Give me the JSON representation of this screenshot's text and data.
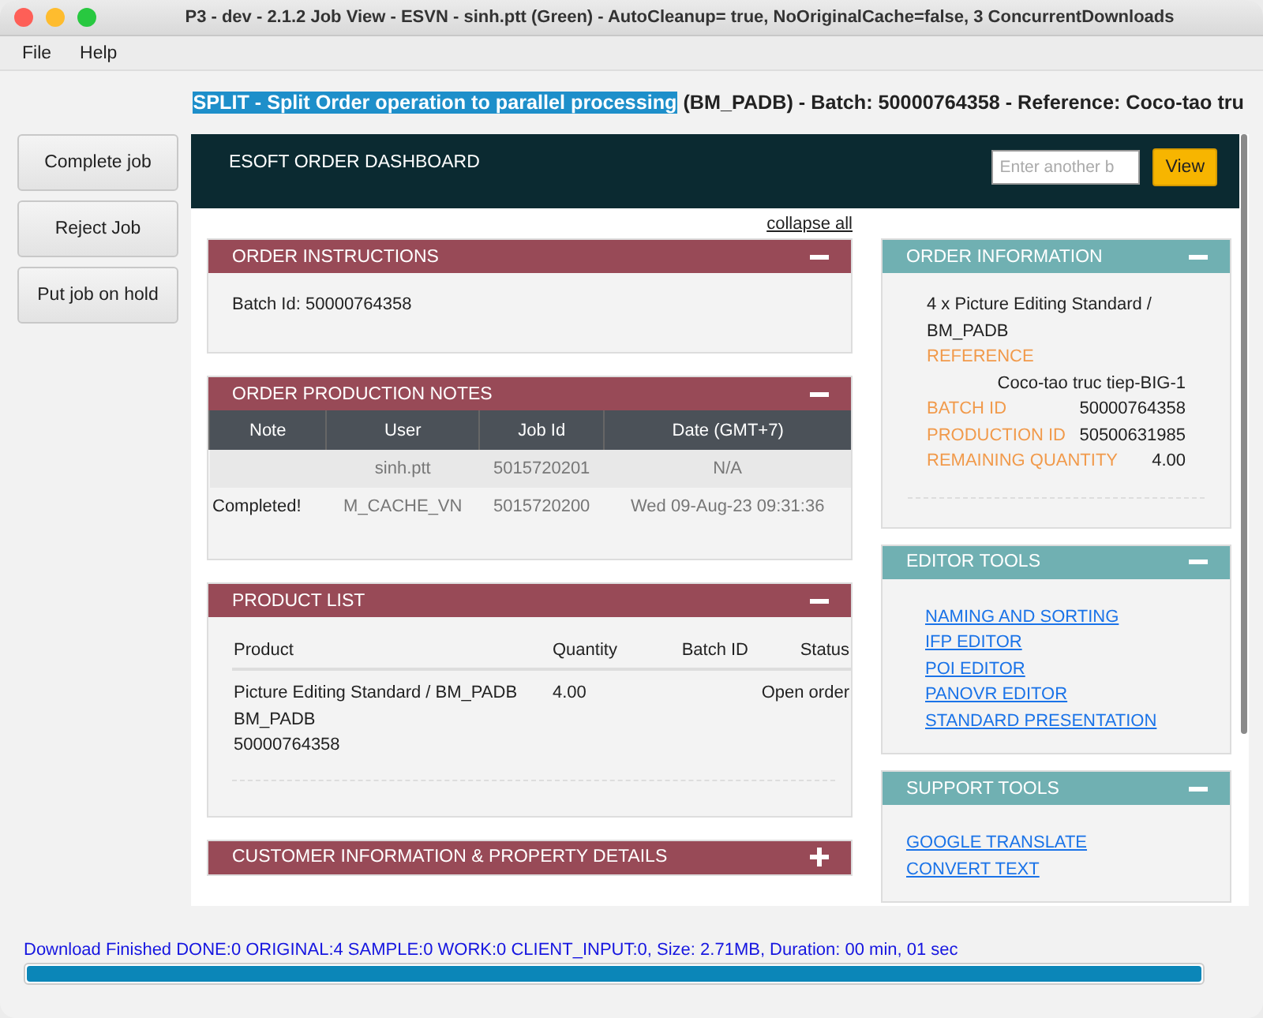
{
  "window": {
    "title": "P3 - dev - 2.1.2 Job View  - ESVN - sinh.ptt (Green) - AutoCleanup= true, NoOriginalCache=false, 3 ConcurrentDownloads"
  },
  "menu": [
    "File",
    "Help"
  ],
  "heading": {
    "highlighted": "SPLIT - Split Order operation to parallel processing",
    "rest": "(BM_PADB) - Batch: 50000764358 - Reference: Coco-tao tru"
  },
  "actions": [
    "Complete job",
    "Reject Job",
    "Put job on hold"
  ],
  "dashboard": {
    "title": "ESOFT ORDER DASHBOARD",
    "search": {
      "placeholder": "Enter another b"
    },
    "view_button": "View",
    "collapse_all": "collapse all",
    "left_panels": [
      {
        "kind": "text",
        "title": "ORDER INSTRUCTIONS",
        "expanded": true,
        "text": "Batch Id: 50000764358"
      },
      {
        "kind": "notes",
        "title": "ORDER PRODUCTION NOTES",
        "expanded": true,
        "columns": [
          "Note",
          "User",
          "Job Id",
          "Date (GMT+7)"
        ],
        "rows": [
          {
            "note": "",
            "user": "sinh.ptt",
            "job_id": "5015720201",
            "date": "N/A"
          },
          {
            "note": "Completed!",
            "user": "M_CACHE_VN",
            "job_id": "5015720200",
            "date": "Wed 09-Aug-23 09:31:36"
          }
        ]
      },
      {
        "kind": "products",
        "title": "PRODUCT LIST",
        "expanded": true,
        "columns": [
          "Product",
          "Quantity",
          "Batch ID",
          "Status"
        ],
        "rows": [
          {
            "product": [
              "Picture Editing Standard / BM_PADB",
              "BM_PADB",
              "50000764358"
            ],
            "quantity": "4.00",
            "batch_id": "",
            "status": "Open order"
          }
        ]
      },
      {
        "kind": "text",
        "title": "CUSTOMER INFORMATION & PROPERTY DETAILS",
        "expanded": false
      }
    ],
    "right_panels": [
      {
        "kind": "info",
        "title": "ORDER INFORMATION",
        "expanded": true,
        "summary": "4 x Picture Editing Standard / BM_PADB",
        "fields": [
          {
            "label": "REFERENCE",
            "value": "Coco-tao truc tiep-BIG-1"
          },
          {
            "label": "BATCH ID",
            "value": "50000764358"
          },
          {
            "label": "PRODUCTION ID",
            "value": "50500631985"
          },
          {
            "label": "REMAINING QUANTITY",
            "value": "4.00"
          }
        ]
      },
      {
        "kind": "indented_links",
        "title": "EDITOR TOOLS",
        "expanded": true,
        "links": [
          "NAMING AND SORTING",
          "IFP EDITOR",
          "POI EDITOR",
          "PANOVR EDITOR",
          "STANDARD PRESENTATION"
        ]
      },
      {
        "kind": "links",
        "title": "SUPPORT TOOLS",
        "expanded": true,
        "links": [
          "GOOGLE TRANSLATE",
          "CONVERT TEXT"
        ]
      }
    ]
  },
  "status_bar": {
    "text": "Download Finished DONE:0 ORIGINAL:4 SAMPLE:0 WORK:0 CLIENT_INPUT:0, Size: 2.71MB, Duration: 00 min, 01 sec",
    "level": 1.0
  }
}
